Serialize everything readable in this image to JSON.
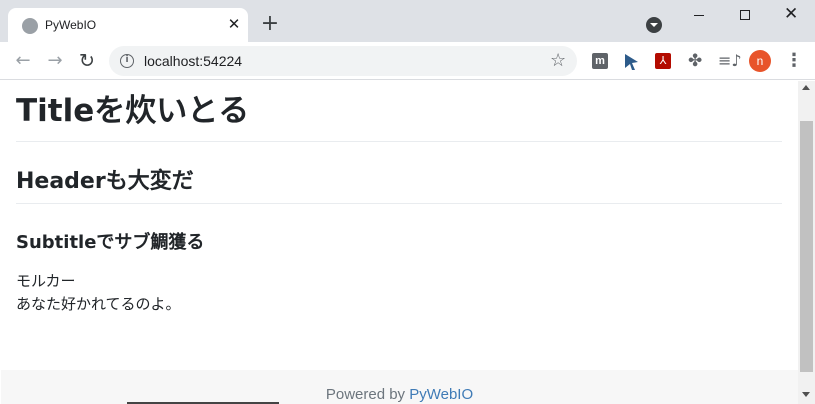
{
  "browser": {
    "tab": {
      "title": "PyWebIO",
      "close_glyph": "✕"
    },
    "new_tab_glyph": "+",
    "window_controls": {
      "minimize": "minimize",
      "maximize": "maximize",
      "close": "✕"
    },
    "nav": {
      "back": "←",
      "forward": "→",
      "reload": "↻"
    },
    "address": {
      "info_glyph": "i",
      "url": "localhost:54224"
    },
    "bookmark_glyph": "☆",
    "extensions": [
      {
        "name": "m-extension-icon",
        "glyph": "m"
      },
      {
        "name": "cursor-extension-icon",
        "glyph": ""
      },
      {
        "name": "pdf-extension-icon",
        "glyph": "⅄"
      },
      {
        "name": "puzzle-icon",
        "glyph": "✤"
      },
      {
        "name": "media-queue-icon",
        "glyph": "≡♪"
      }
    ],
    "profile_initial": "n",
    "menu_glyph": "⋮",
    "colors": {
      "profile": "#e8542a",
      "pdf": "#b30b00",
      "link": "#3f7bb6"
    }
  },
  "page": {
    "title": "Titleを炊いとる",
    "header": "Headerも大変だ",
    "subtitle": "Subtitleでサブ鯛獲る",
    "text_lines": [
      "モルカー",
      "あなた好かれてるのよ。"
    ],
    "footer": {
      "prefix": "Powered by ",
      "link": "PyWebIO"
    }
  }
}
